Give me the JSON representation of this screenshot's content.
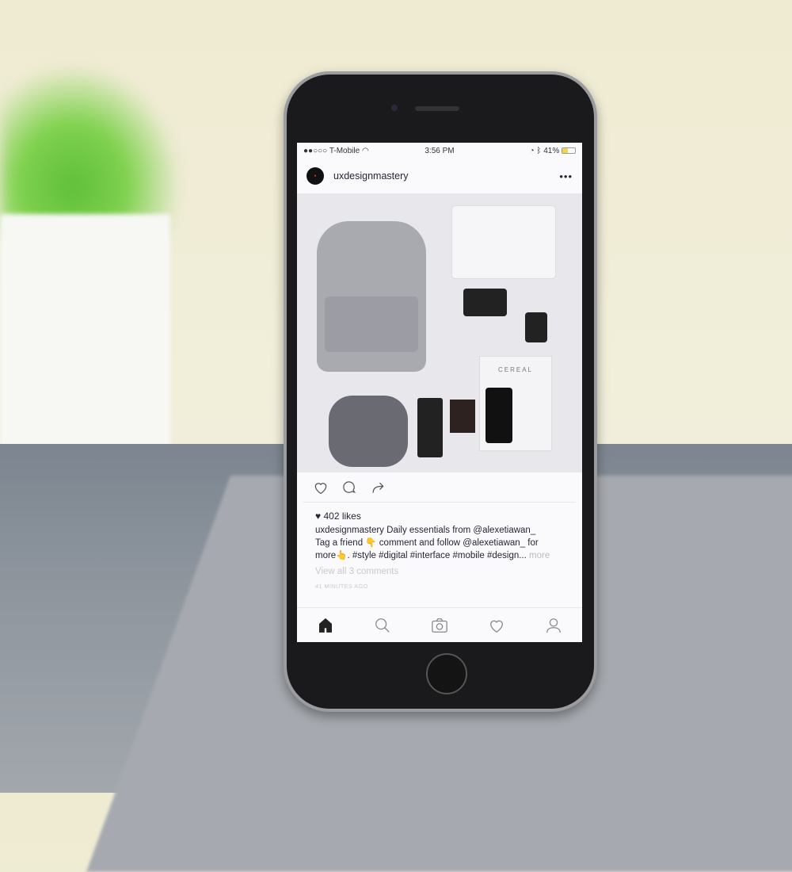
{
  "status_bar": {
    "carrier": "T-Mobile",
    "time": "3:56 PM",
    "battery": "41%",
    "battery_level": 0.41,
    "signal_bars": 2
  },
  "post": {
    "username": "uxdesignmastery",
    "more_icon": "ellipsis-icon",
    "likes": "402 likes",
    "caption_user": "uxdesignmastery",
    "caption_line1": "Daily essentials from @alexetiawan_",
    "caption_line2": "Tag a friend 👇 comment and follow @alexetiawan_ for",
    "caption_line3": "more👆. #style #digital #interface #mobile #design...",
    "more_label": "more",
    "view_comments": "View all 3 comments",
    "timestamp": "41 MINUTES AGO",
    "photo_text": "CEREAL"
  },
  "tabbar": {
    "items": [
      "home-icon",
      "search-icon",
      "camera-icon",
      "heart-icon",
      "profile-icon"
    ],
    "active": "home-icon"
  }
}
